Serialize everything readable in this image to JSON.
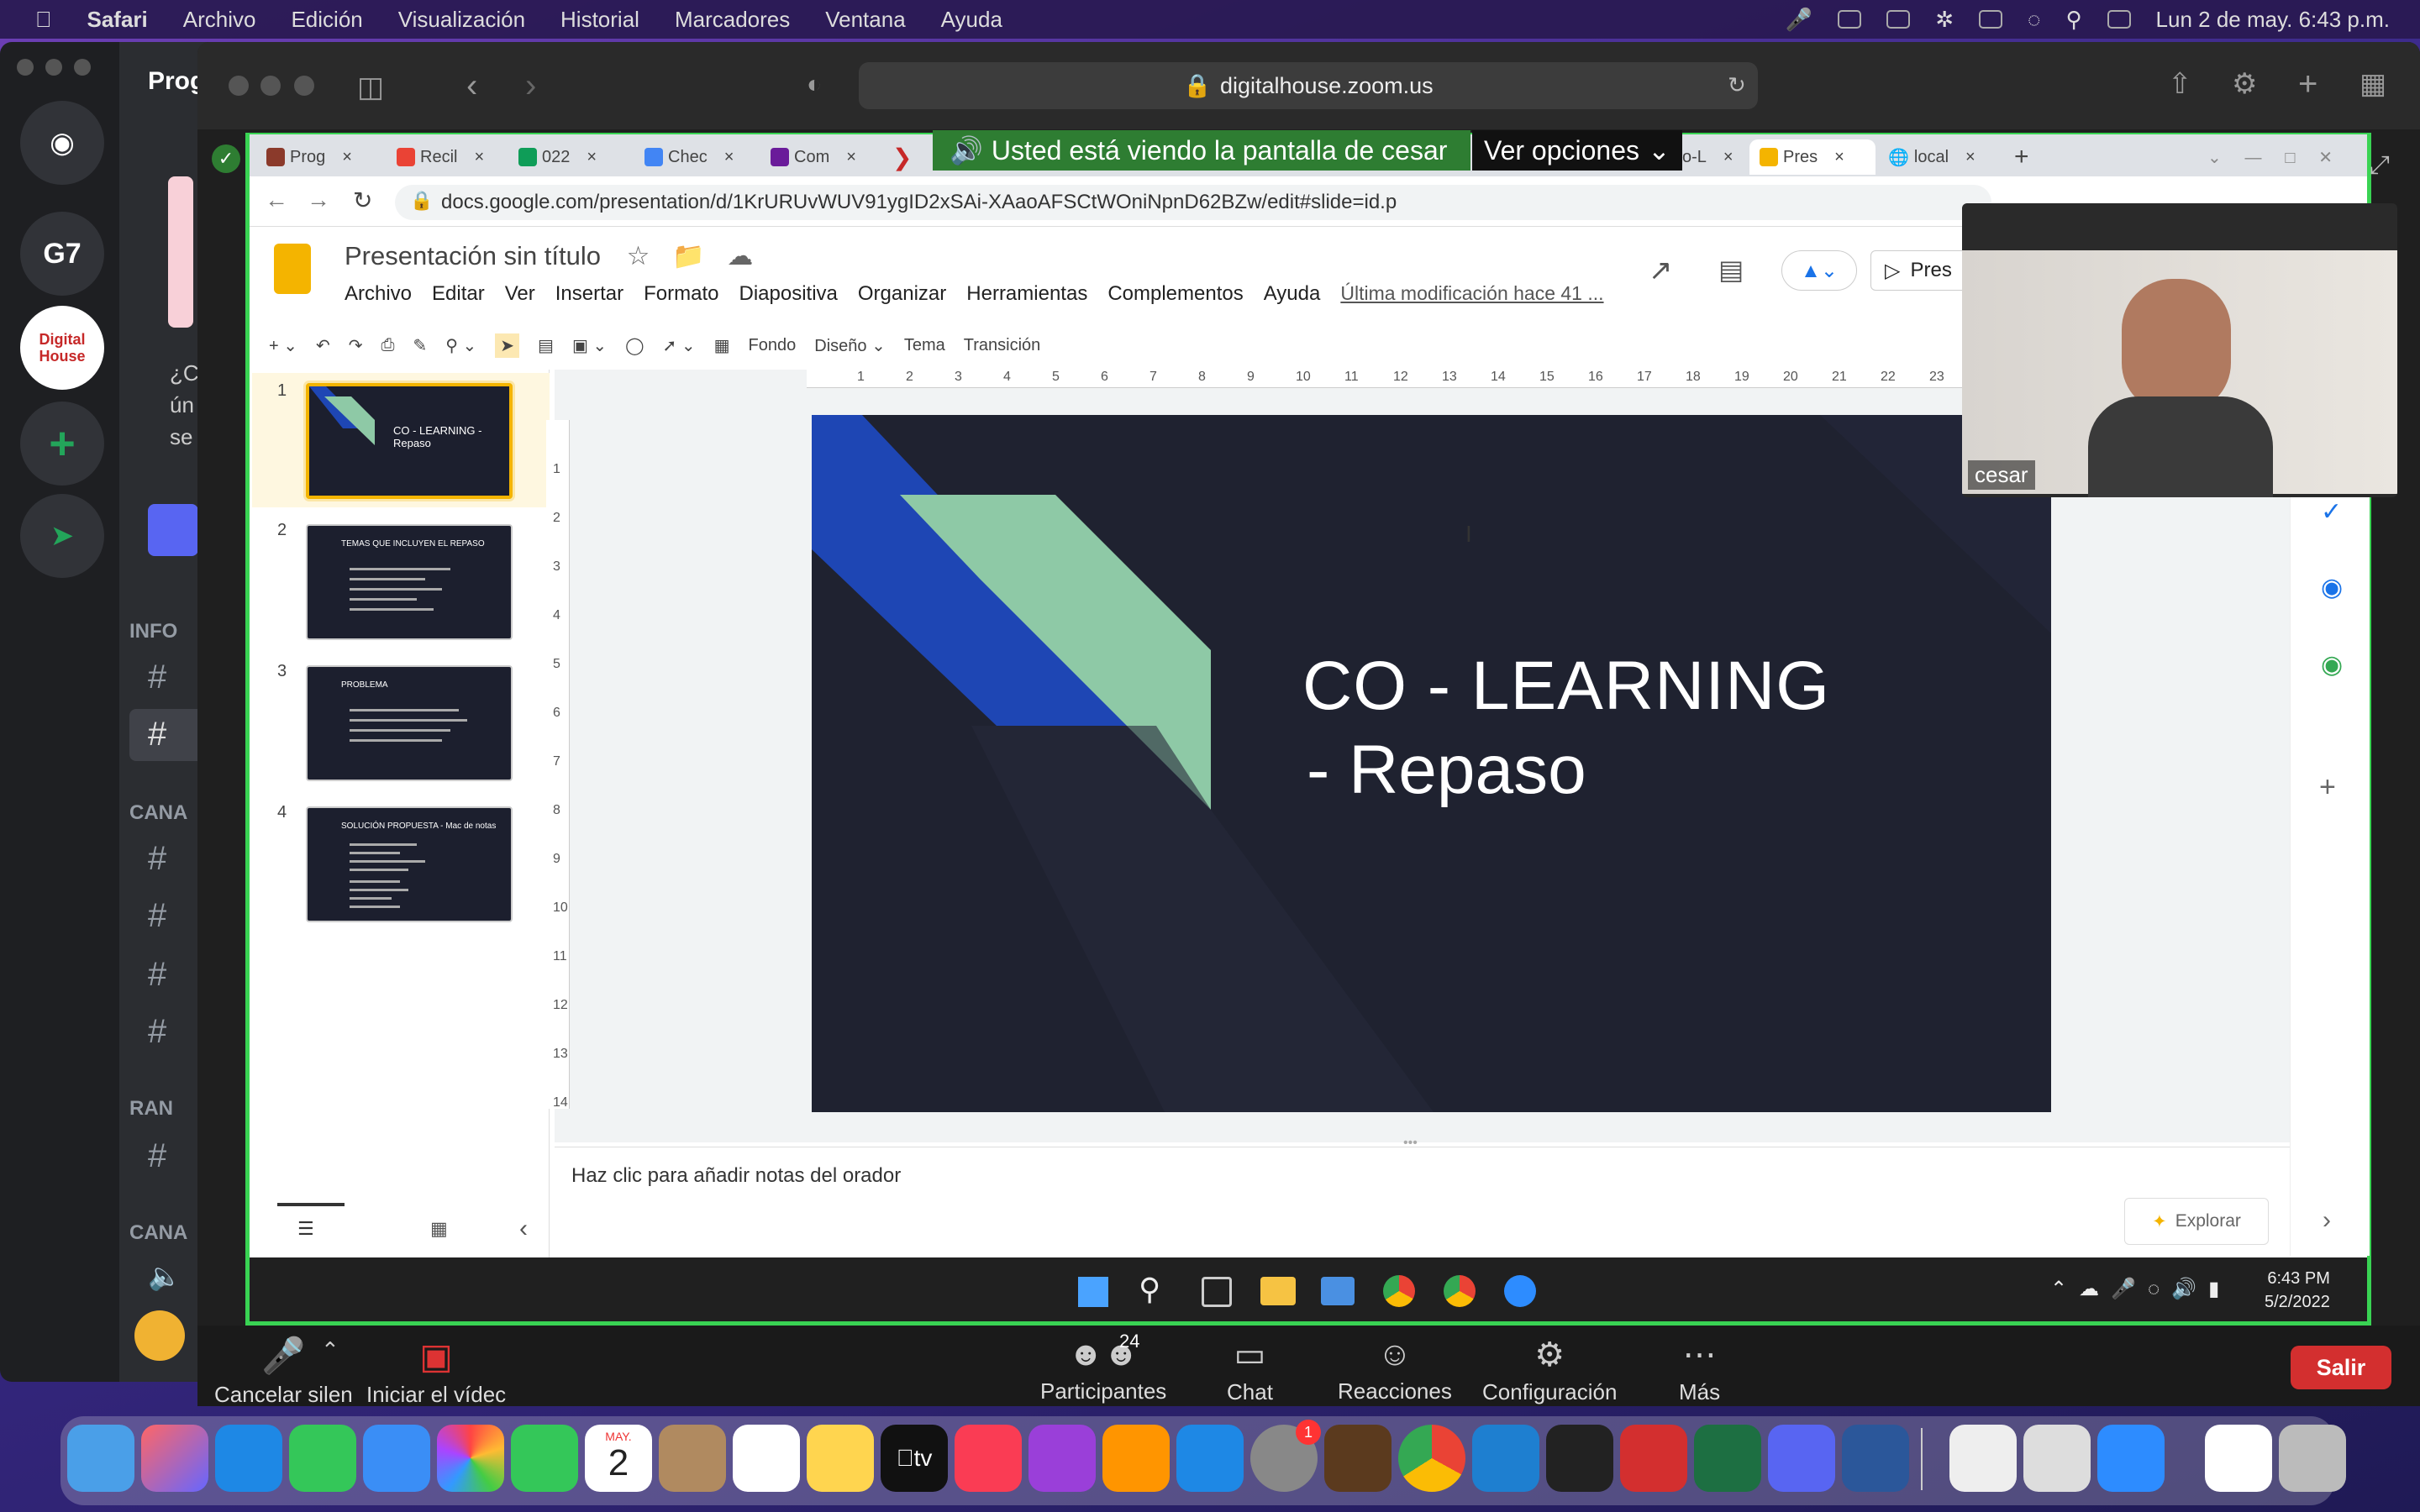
{
  "menubar": {
    "app": "Safari",
    "items": [
      "Archivo",
      "Edición",
      "Visualización",
      "Historial",
      "Marcadores",
      "Ventana",
      "Ayuda"
    ],
    "clock": "Lun 2 de may.  6:43 p.m."
  },
  "discord": {
    "servers": [
      "G7",
      "Digital House"
    ],
    "partial_title": "Prog",
    "partial_text": [
      "¿C",
      "ún",
      "se"
    ],
    "categories": [
      "INFO",
      "CANA",
      "RAN",
      "CANA"
    ]
  },
  "safari": {
    "url": "digitalhouse.zoom.us"
  },
  "zoom": {
    "share_banner": "Usted está viendo la pantalla de cesar",
    "options_label": "Ver opciones",
    "controls": [
      {
        "label": "Cancelar silen"
      },
      {
        "label": "Iniciar el vídec"
      },
      {
        "label": "Participantes",
        "badge": "24"
      },
      {
        "label": "Chat"
      },
      {
        "label": "Reacciones"
      },
      {
        "label": "Configuración"
      },
      {
        "label": "Más"
      }
    ],
    "leave": "Salir",
    "participant_name": "cesar"
  },
  "chrome": {
    "tabs": [
      "Prog",
      "Recil",
      "022",
      "Chec",
      "Com",
      "o-L",
      "Pres",
      "local"
    ],
    "address": "docs.google.com/presentation/d/1KrURUvWUV91ygID2xSAi-XAaoAFSCtWOniNpnD62BZw/edit#slide=id.p"
  },
  "slides": {
    "doc_title": "Presentación sin título",
    "menu": [
      "Archivo",
      "Editar",
      "Ver",
      "Insertar",
      "Formato",
      "Diapositiva",
      "Organizar",
      "Herramientas",
      "Complementos",
      "Ayuda"
    ],
    "last_modified": "Última modificación hace 41 ...",
    "present_label": "Pres",
    "toolbar": [
      "Fondo",
      "Diseño",
      "Tema",
      "Transición"
    ],
    "thumbnails": [
      {
        "n": "1",
        "title": "CO - LEARNING - Repaso"
      },
      {
        "n": "2",
        "title": "TEMAS QUE INCLUYEN EL REPASO"
      },
      {
        "n": "3",
        "title": "PROBLEMA"
      },
      {
        "n": "4",
        "title": "SOLUCIÓN PROPUESTA - Mac de notas"
      }
    ],
    "slide_title_line1": "CO - LEARNING",
    "slide_title_line2": "-  Repaso",
    "notes_placeholder": "Haz clic para añadir notas del orador",
    "explore": "Explorar",
    "ruler": [
      "1",
      "2",
      "3",
      "4",
      "5",
      "6",
      "7",
      "8",
      "9",
      "10",
      "11",
      "12",
      "13",
      "14",
      "15",
      "16",
      "17",
      "18",
      "19",
      "20",
      "21",
      "22",
      "23"
    ],
    "vruler": [
      "1",
      "2",
      "3",
      "4",
      "5",
      "6",
      "7",
      "8",
      "9",
      "10",
      "11",
      "12",
      "13",
      "14"
    ]
  },
  "windows": {
    "time": "6:43 PM",
    "date": "5/2/2022"
  },
  "dock": {
    "calendar_month": "MAY.",
    "calendar_day": "2",
    "settings_badge": "1"
  },
  "colors": {
    "slide_bg": "#1f2230",
    "slide_blue": "#1e46b4",
    "slide_mint": "#8ec9a6",
    "zoom_green": "#39d353",
    "salir": "#d32f2f"
  }
}
